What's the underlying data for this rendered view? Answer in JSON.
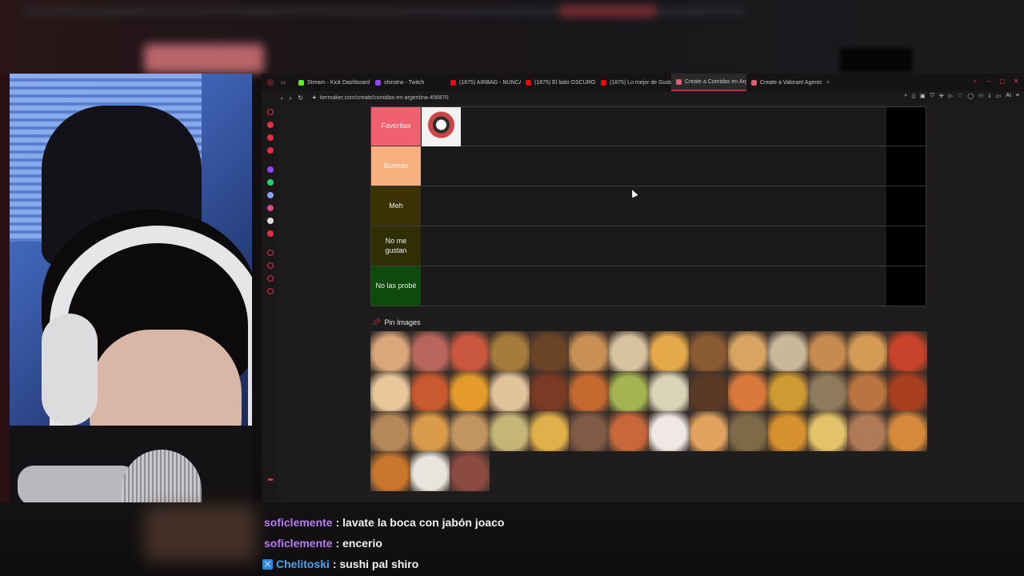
{
  "browser": {
    "tabs": [
      {
        "label": "Stream - Kick Dashboard",
        "color": "#53fc18"
      },
      {
        "label": "shirotrw - Twitch",
        "color": "#9146ff"
      },
      {
        "label": "(1875) AIRBAG - NUNCA",
        "color": "#ff0000"
      },
      {
        "label": "(1875) El lado OSCURO d",
        "color": "#ff0000"
      },
      {
        "label": "(1875) Lo mejor de Gusta",
        "color": "#ff0000"
      },
      {
        "label": "Create a Comidas en Arg",
        "color": "#e35d6a"
      },
      {
        "label": "Create a Valorant Agents",
        "color": "#e35d6a"
      }
    ],
    "url": "tiermaker.com/create/comidas-en-argentina-456870",
    "ai_label": "AI"
  },
  "tiers": [
    {
      "label": "Favoritas",
      "color": "#f0606e"
    },
    {
      "label": "Buenas",
      "color": "#f7b07d"
    },
    {
      "label": "Meh",
      "color": "#3b3104"
    },
    {
      "label": "No me gustan",
      "color": "#2f2e05"
    },
    {
      "label": "No las probé",
      "color": "#0d4a0c"
    }
  ],
  "pin_images": {
    "title": "Pin Images",
    "colors": [
      "#d9a77a",
      "#b8665c",
      "#c9573e",
      "#a67b3b",
      "#6b4428",
      "#c89055",
      "#d7c3a0",
      "#e6a94a",
      "#8a5a33",
      "#d8a461",
      "#c9b89a",
      "#c68b4e",
      "#d59a55",
      "#c8432a",
      "#e8c79a",
      "#c85a2f",
      "#e59b2b",
      "#e2c39a",
      "#7a3a24",
      "#c4692f",
      "#a2b552",
      "#d9d3b8",
      "#5a3a26",
      "#d87a3c",
      "#cf9a32",
      "#8f7a5c",
      "#b9743f",
      "#a8401f",
      "#b5885a",
      "#d99a4a",
      "#c29560",
      "#c6b577",
      "#e0b14a",
      "#7f5a45",
      "#c8683a",
      "#efe8e4",
      "#e1a35f",
      "#7e6a48",
      "#d7902e",
      "#e2c36a",
      "#b07a57",
      "#d48a3a",
      "#c9762f",
      "#e9e4de",
      "#8c4b42"
    ]
  },
  "chat": [
    {
      "user": "soficlemente",
      "user_color": "#b77cf3",
      "message": ": lavate la boca con jabón joaco",
      "badge": ""
    },
    {
      "user": "soficlemente",
      "user_color": "#b77cf3",
      "message": ": encerio",
      "badge": ""
    },
    {
      "user": "Chelitoski",
      "user_color": "#4aa3f0",
      "message": ": sushi pal shiro",
      "badge": "⤫"
    }
  ]
}
